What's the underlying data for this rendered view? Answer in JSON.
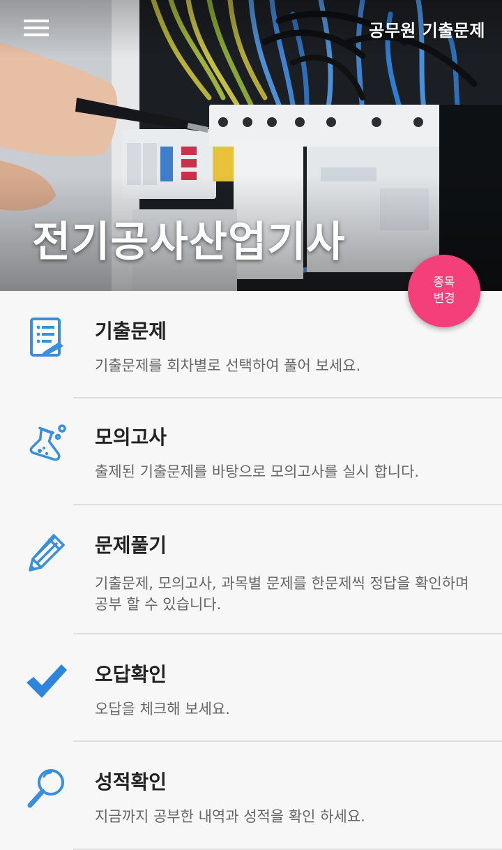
{
  "header": {
    "menu_icon": "hamburger-menu-icon",
    "app_title": "공무원 기출문제",
    "subject_title": "전기공사산업기사"
  },
  "fab": {
    "line1": "종목",
    "line2": "변경",
    "color": "#f4407a"
  },
  "accent_color": "#3a8fdc",
  "menu": {
    "items": [
      {
        "icon": "notebook-icon",
        "title": "기출문제",
        "desc": "기출문제를 회차별로 선택하여 풀어 보세요."
      },
      {
        "icon": "flask-icon",
        "title": "모의고사",
        "desc": "출제된 기출문제를 바탕으로 모의고사를 실시 합니다."
      },
      {
        "icon": "pencil-icon",
        "title": "문제풀기",
        "desc": "기출문제, 모의고사, 과목별 문제를 한문제씩 정답을 확인하며 공부 할 수 있습니다."
      },
      {
        "icon": "checkmark-icon",
        "title": "오답확인",
        "desc": "오답을 체크해 보세요."
      },
      {
        "icon": "magnifier-icon",
        "title": "성적확인",
        "desc": "지금까지 공부한 내역과 성적을 확인 하세요."
      }
    ]
  }
}
